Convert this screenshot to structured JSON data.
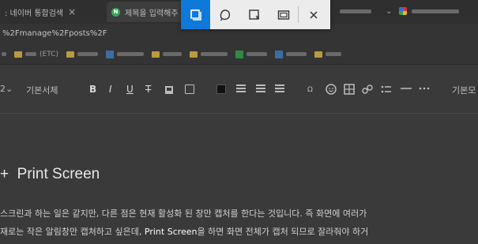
{
  "browser": {
    "tabs": [
      {
        "title": ": 네이버 통합검색",
        "close": "×"
      },
      {
        "title": "제목을 입력해주",
        "favicon": "N"
      }
    ],
    "tab_right": "⌄",
    "url": "%2Fmanage%2Fposts%2F",
    "bookmarks": [
      {
        "label": "(ETC)"
      }
    ]
  },
  "editor_toolbar": {
    "font_size": "2",
    "font_name": "기본서체",
    "bold": "B",
    "italic": "I",
    "underline": "U",
    "strikethrough": "T",
    "align_more": "기본모"
  },
  "document": {
    "heading_bullet": "+",
    "heading": "Print Screen",
    "para1": "스크린과 하는 일은 같지만, 다른 점은 현재 활성화 된 창만 캡처를 한다는 것입니다. 즉 화면에 여러가",
    "para2_a": "재로는 작은 알림창만 캡쳐하고 싶은데, ",
    "para2_hl": "Print Screen",
    "para2_b": "을 하면 화면 전체가 캡처 되므로 잘라줘야 하거"
  },
  "snip_toolbar": {
    "buttons": [
      {
        "name": "rectangle-snip",
        "active": true
      },
      {
        "name": "freeform-snip",
        "active": false
      },
      {
        "name": "window-snip",
        "active": false
      },
      {
        "name": "fullscreen-snip",
        "active": false
      },
      {
        "name": "close",
        "active": false
      }
    ],
    "accent": "#0f79d9"
  }
}
